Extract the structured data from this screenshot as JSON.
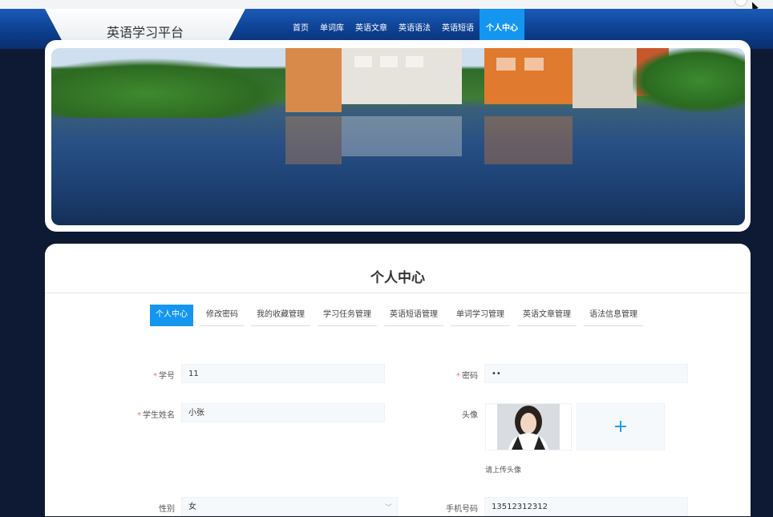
{
  "app": {
    "title": "英语学习平台"
  },
  "nav": {
    "items": [
      {
        "label": "首页"
      },
      {
        "label": "单词库"
      },
      {
        "label": "英语文章"
      },
      {
        "label": "英语语法"
      },
      {
        "label": "英语短语"
      },
      {
        "label": "个人中心",
        "active": true
      }
    ]
  },
  "page": {
    "title": "个人中心"
  },
  "tabs": [
    {
      "label": "个人中心",
      "active": true
    },
    {
      "label": "修改密码"
    },
    {
      "label": "我的收藏管理"
    },
    {
      "label": "学习任务管理"
    },
    {
      "label": "英语短语管理"
    },
    {
      "label": "单词学习管理"
    },
    {
      "label": "英语文章管理"
    },
    {
      "label": "语法信息管理"
    }
  ],
  "form": {
    "student_id": {
      "label": "学号",
      "value": "11",
      "required": true
    },
    "password": {
      "label": "密码",
      "value": "••",
      "required": true
    },
    "student_name": {
      "label": "学生姓名",
      "value": "小张",
      "required": true
    },
    "avatar": {
      "label": "头像",
      "hint": "请上传头像",
      "upload_icon": "+"
    },
    "gender": {
      "label": "性别",
      "value": "女"
    },
    "phone": {
      "label": "手机号码",
      "value": "13512312312"
    },
    "required_mark": "*"
  },
  "colors": {
    "accent": "#1496f0",
    "nav_bg": "#0d3f8f",
    "page_bg": "#0e1a33",
    "required": "#f56c6c"
  }
}
